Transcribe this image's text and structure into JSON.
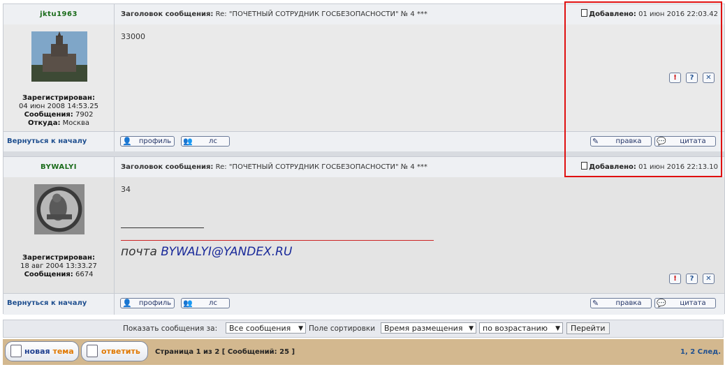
{
  "posts": [
    {
      "author": "jktu1963",
      "subject_label": "Заголовок сообщения:",
      "subject": "Re: \"ПОЧЕТНЫЙ СОТРУДНИК ГОСБЕЗОПАСНОСТИ\" № 4 ***",
      "posted_label": "Добавлено:",
      "posted": "01 июн 2016 22:03.42",
      "registered_label": "Зарегистрирован:",
      "registered": "04 июн 2008 14:53.25",
      "messages_label": "Сообщения:",
      "messages": "7902",
      "from_label": "Откуда:",
      "from": "Москва",
      "message": "33000",
      "avatar_icon": "building-photo"
    },
    {
      "author": "BYWALYI",
      "subject_label": "Заголовок сообщения:",
      "subject": "Re: \"ПОЧЕТНЫЙ СОТРУДНИК ГОСБЕЗОПАСНОСТИ\" № 4 ***",
      "posted_label": "Добавлено:",
      "posted": "01 июн 2016 22:13.10",
      "registered_label": "Зарегистрирован:",
      "registered": "18 авг 2004 13:33.27",
      "messages_label": "Сообщения:",
      "messages": "6674",
      "message": "34",
      "signature_prefix": "почта",
      "signature_email": "BYWALYI@YANDEX.RU",
      "avatar_icon": "worker-photo"
    }
  ],
  "post_actions": {
    "report": "!",
    "info": "?",
    "delete": "✕",
    "back_to_top": "Вернуться к началу",
    "profile": "профиль",
    "pm": "лс",
    "edit": "правка",
    "quote": "цитата"
  },
  "sort": {
    "show_label": "Показать сообщения за:",
    "show_value": "Все сообщения",
    "sort_label": "Поле сортировки",
    "sort_value": "Время размещения",
    "order_value": "по возрастанию",
    "go": "Перейти"
  },
  "bottom": {
    "new_topic_prefix": "новая",
    "new_topic_suffix": "тема",
    "reply": "ответить",
    "page_info": "Страница 1 из 2 [ Сообщений: 25 ]",
    "pages": "1, 2",
    "next": "След."
  },
  "colors": {
    "highlight": "#e01010",
    "bottom_bar": "#d3b88f",
    "link": "#1f4f8f"
  }
}
